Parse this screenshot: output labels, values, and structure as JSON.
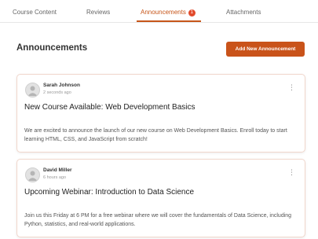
{
  "tabs": [
    {
      "label": "Course Content"
    },
    {
      "label": "Reviews"
    },
    {
      "label": "Announcements",
      "badge": "1",
      "active": true
    },
    {
      "label": "Attachments"
    }
  ],
  "header": {
    "title": "Announcements",
    "add_button_label": "Add New Announcement"
  },
  "announcements": [
    {
      "author": "Sarah Johnson",
      "time": "2 seconds ago",
      "title": "New Course Available: Web Development Basics",
      "body": "We are excited to announce the launch of our new course on Web Development Basics. Enroll today to start learning HTML, CSS, and JavaScript from scratch!"
    },
    {
      "author": "David Miller",
      "time": "6 hours ago",
      "title": "Upcoming Webinar: Introduction to Data Science",
      "body": "Join us this Friday at 6 PM for a free webinar where we will cover the fundamentals of Data Science, including Python, statistics, and real-world applications."
    }
  ],
  "colors": {
    "accent": "#c9531a",
    "badge": "#e24a2b"
  },
  "icons": {
    "more": "more-vertical-icon",
    "avatar": "user-avatar-icon"
  }
}
